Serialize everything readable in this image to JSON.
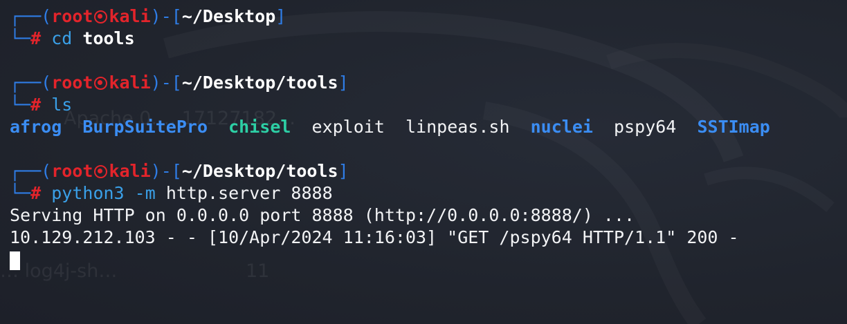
{
  "prompt": {
    "user": "root",
    "host": "kali",
    "skull_icon": "kali-skull-icon"
  },
  "blocks": [
    {
      "path": "~/Desktop",
      "command": "cd",
      "argument": "tools"
    },
    {
      "path": "~/Desktop/tools",
      "command": "ls",
      "argument": ""
    },
    {
      "path": "~/Desktop/tools",
      "command": "python3 -m",
      "argument": "http.server 8888"
    }
  ],
  "ls_output": [
    {
      "name": "afrog",
      "type": "dir"
    },
    {
      "name": "BurpSuitePro",
      "type": "dir"
    },
    {
      "name": "chisel",
      "type": "exec"
    },
    {
      "name": "exploit",
      "type": "file"
    },
    {
      "name": "linpeas.sh",
      "type": "file"
    },
    {
      "name": "nuclei",
      "type": "dir"
    },
    {
      "name": "pspy64",
      "type": "file"
    },
    {
      "name": "SSTImap",
      "type": "dir"
    }
  ],
  "server_output": [
    "Serving HTTP on 0.0.0.0 port 8888 (http://0.0.0.0:8888/) ...",
    "10.129.212.103 - - [10/Apr/2024 11:16:03] \"GET /pspy64 HTTP/1.1\" 200 -"
  ],
  "ghost_text": {
    "line1": "Apache 0.… 17127182…",
    "line2": "… log4j-sh…",
    "line3": "11"
  },
  "colors": {
    "background": "#21252f",
    "prompt_box": "#2f7de6",
    "root_user": "#e3242b",
    "command": "#3aa0e8",
    "directory": "#3b8df3",
    "executable": "#2dcfa5"
  }
}
